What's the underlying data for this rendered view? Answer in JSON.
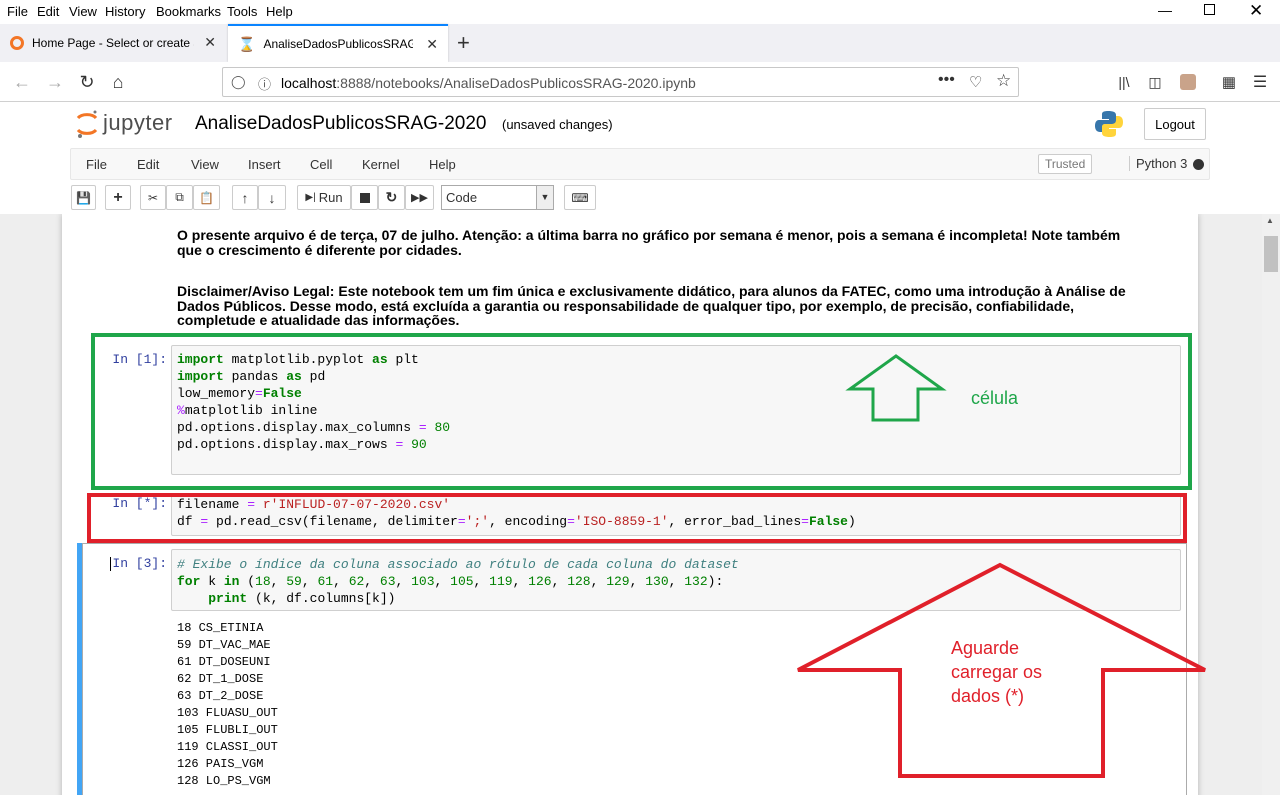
{
  "browser": {
    "menu": [
      "File",
      "Edit",
      "View",
      "History",
      "Bookmarks",
      "Tools",
      "Help"
    ],
    "tabs": [
      {
        "title": "Home Page - Select or create a",
        "active": false
      },
      {
        "title": "AnaliseDadosPublicosSRAG-2020",
        "active": true
      }
    ],
    "url_host": "localhost",
    "url_rest": ":8888/notebooks/AnaliseDadosPublicosSRAG-2020.ipynb"
  },
  "jupyter": {
    "logo_text": "jupyter",
    "notebook_title": "AnaliseDadosPublicosSRAG-2020",
    "unsaved": "(unsaved changes)",
    "logout": "Logout",
    "menu": [
      "File",
      "Edit",
      "View",
      "Insert",
      "Cell",
      "Kernel",
      "Help"
    ],
    "trusted": "Trusted",
    "kernel": "Python 3",
    "run_label": "Run",
    "cell_type": "Code"
  },
  "markdown": {
    "p1_line1": "O presente arquivo é de terça, 07 de julho. Atenção: a última barra no gráfico por semana é menor, pois a semana é incompleta! Note também",
    "p1_line2": "que o crescimento é diferente por cidades.",
    "p2_line1": "Disclaimer/Aviso Legal: Este notebook tem um fim única e exclusivamente didático, para alunos da FATEC, como uma introdução à Análise de",
    "p2_line2": "Dados Públicos. Desse modo, está excluída a garantia ou responsabilidade de qualquer tipo, por exemplo, de precisão, confiabilidade,",
    "p2_line3": "completude e atualidade das informações."
  },
  "cells": {
    "c1_prompt": "In [1]:",
    "c2_prompt": "In [*]:",
    "c3_prompt": "In [3]:",
    "c3_comment": "# Exibe o índice da coluna associado ao rótulo de cada coluna do dataset"
  },
  "outputs": [
    "18 CS_ETINIA",
    "59 DT_VAC_MAE",
    "61 DT_DOSEUNI",
    "62 DT_1_DOSE",
    "63 DT_2_DOSE",
    "103 FLUASU_OUT",
    "105 FLUBLI_OUT",
    "119 CLASSI_OUT",
    "126 PAIS_VGM",
    "128 LO_PS_VGM"
  ],
  "annotations": {
    "green_label": "célula",
    "red_label_1": "Aguarde",
    "red_label_2": "carregar os",
    "red_label_3": "dados (*)",
    "green_color": "#1fa64a",
    "red_color": "#e0202a"
  }
}
